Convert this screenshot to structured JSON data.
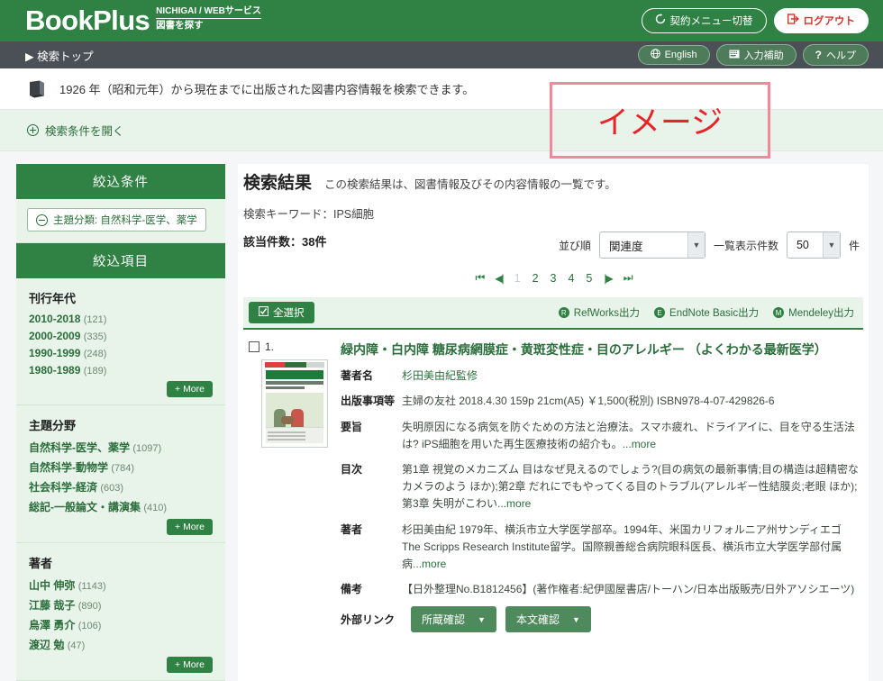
{
  "header": {
    "logo_main": "BookPlus",
    "logo_sub_top": "NICHIGAI / WEBサービス",
    "logo_sub_bottom": "図書を探す",
    "contract_button": "契約メニュー切替",
    "contract_icon": "refresh-icon",
    "logout_button": "ログアウト",
    "logout_icon": "logout-icon",
    "brand_green": "#2f8244",
    "logout_red": "#d8342a"
  },
  "navbar": {
    "top_link": "▶ 検索トップ",
    "english_button": "English",
    "english_icon": "globe-icon",
    "input_help_button": "入力補助",
    "input_help_icon": "keyboard-icon",
    "help_button": "ヘルプ",
    "help_icon": "question-icon"
  },
  "info": {
    "icon": "book-icon",
    "text": "1926 年（昭和元年）から現在までに出版された図書内容情報を検索できます。"
  },
  "search_condition": {
    "icon": "plus-circle-icon",
    "label": "検索条件を開く"
  },
  "image_callout": {
    "text": "イメージ",
    "border_color": "#f4889b",
    "text_color": "#e8232a"
  },
  "sidebar": {
    "refine_conditions_title": "絞込条件",
    "active_chip": {
      "icon": "minus-circle-icon",
      "label": "主題分類: 自然科学-医学、薬学"
    },
    "refine_items_title": "絞込項目",
    "more_label": "+ More",
    "facets": [
      {
        "title": "刊行年代",
        "items": [
          {
            "label": "2010-2018",
            "count": "(121)"
          },
          {
            "label": "2000-2009",
            "count": "(335)"
          },
          {
            "label": "1990-1999",
            "count": "(248)"
          },
          {
            "label": "1980-1989",
            "count": "(189)"
          }
        ]
      },
      {
        "title": "主題分野",
        "items": [
          {
            "label": "自然科学-医学、薬学",
            "count": "(1097)"
          },
          {
            "label": "自然科学-動物学",
            "count": "(784)"
          },
          {
            "label": "社会科学-経済",
            "count": "(603)"
          },
          {
            "label": "総記-一般論文・講演集",
            "count": "(410)"
          }
        ]
      },
      {
        "title": "著者",
        "items": [
          {
            "label": "山中 伸弥",
            "count": "(1143)"
          },
          {
            "label": "江藤 哉子",
            "count": "(890)"
          },
          {
            "label": "烏澤 勇介",
            "count": "(106)"
          },
          {
            "label": "渡辺 勉",
            "count": "(47)"
          }
        ]
      }
    ]
  },
  "results": {
    "title": "検索結果",
    "subtitle": "この検索結果は、図書情報及びその内容情報の一覧です。",
    "keyword_line": "検索キーワード：IPS細胞",
    "hit_count_line": "該当件数：38件",
    "sort_label": "並び順",
    "sort_value": "関連度",
    "per_page_label": "一覧表示件数",
    "per_page_value": "50",
    "per_page_unit": "件",
    "pagination": {
      "first": "⏮",
      "prev": "◀|",
      "pages": [
        "1",
        "2",
        "3",
        "4",
        "5"
      ],
      "current": "1",
      "next": "|▶",
      "last": "⏭"
    },
    "toolbar": {
      "select_all": "全選択",
      "select_all_icon": "check-square-icon",
      "exports": [
        {
          "label": "RefWorks出力",
          "icon": "refworks-icon"
        },
        {
          "label": "EndNote Basic出力",
          "icon": "endnote-icon"
        },
        {
          "label": "Mendeley出力",
          "icon": "mendeley-icon"
        }
      ]
    },
    "records": [
      {
        "number": "1.",
        "title": "緑内障・白内障 糖尿病網膜症・黄斑変性症・目のアレルギー （よくわかる最新医学）",
        "cover_alt": "book-cover-thumbnail",
        "fields": [
          {
            "label": "著者名",
            "value": "杉田美由紀監修",
            "is_link": true
          },
          {
            "label": "出版事項等",
            "value": "主婦の友社 2018.4.30 159p 21cm(A5) ￥1,500(税別) ISBN978-4-07-429826-6",
            "is_link": false
          },
          {
            "label": "要旨",
            "value": "失明原因になる病気を防ぐための方法と治療法。スマホ疲れ、ドライアイに、目を守る生活法は? iPS細胞を用いた再生医療技術の紹介も。",
            "is_link": false,
            "more": "...more"
          },
          {
            "label": "目次",
            "value": "第1章 視覚のメカニズム 目はなぜ見えるのでしょう?(目の病気の最新事情;目の構造は超精密なカメラのよう ほか);第2章 だれにでもやってくる目のトラブル(アレルギー性結膜炎;老眼 ほか);第3章 失明がこわい",
            "is_link": false,
            "more": "...more"
          },
          {
            "label": "著者",
            "value": "杉田美由紀 1979年、横浜市立大学医学部卒。1994年、米国カリフォルニア州サンディエゴThe Scripps Research Institute留学。国際親善総合病院眼科医長、横浜市立大学医学部付属病",
            "is_link": false,
            "more": "...more"
          },
          {
            "label": "備考",
            "value": "【日外整理No.B1812456】(著作権者:紀伊國屋書店/トーハン/日本出版販売/日外アソシエーツ)",
            "is_link": false
          }
        ],
        "external_links_label": "外部リンク",
        "external_buttons": [
          {
            "label": "所蔵確認",
            "caret": "▼"
          },
          {
            "label": "本文確認",
            "caret": "▼"
          }
        ]
      }
    ]
  }
}
